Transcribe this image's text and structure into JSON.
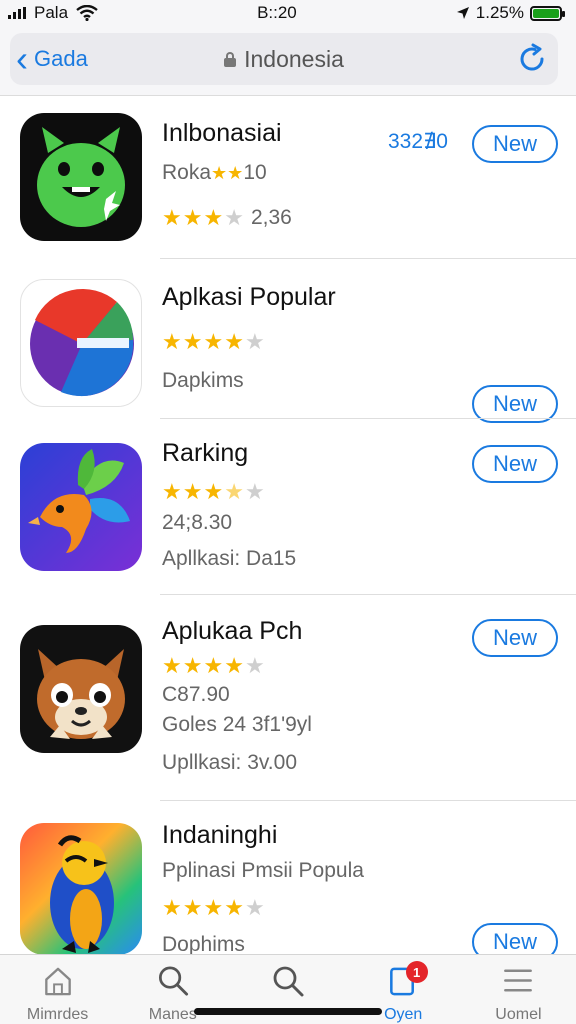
{
  "status_bar": {
    "carrier": "Pala",
    "time": "B::20",
    "battery": "1.25%"
  },
  "nav": {
    "back_label": "Gada",
    "title": "Indonesia"
  },
  "apps": [
    {
      "name": "Inlbonasiai",
      "line1_prefix": "Roka",
      "line1_suffix": "10",
      "rating": 3,
      "rating_text": "2,36",
      "price": "332∄0",
      "button": "New"
    },
    {
      "name": "Aplkasi Popular",
      "rating": 4,
      "line1": "Dapkims",
      "button": "New"
    },
    {
      "name": "Rarking",
      "rating": 3.5,
      "line1": "24;8.30",
      "line2": "Apllkasi: Da15",
      "button": "New"
    },
    {
      "name": "Aplukaa Pch",
      "rating": 4,
      "line1": "C87.90",
      "line2": "Goles 24 3f1'9yl",
      "line3": "Upllkasi: 3v.00",
      "button": "New"
    },
    {
      "name": "Indaninghi",
      "line1": "Pplinasi Pmsii Popula",
      "rating": 4,
      "line2": "Dophims",
      "button": "New"
    }
  ],
  "tabs": [
    {
      "label": "Mimrdes",
      "icon": "home-icon"
    },
    {
      "label": "Manes",
      "icon": "search-icon"
    },
    {
      "label": "",
      "icon": "search-icon"
    },
    {
      "label": "Oyen",
      "icon": "updates-icon",
      "badge": "1",
      "active": true
    },
    {
      "label": "Uomel",
      "icon": "menu-icon"
    }
  ],
  "colors": {
    "accent": "#1a7ae0",
    "star": "#f7b500",
    "badge": "#e4252a",
    "battery": "#1aa01a"
  }
}
